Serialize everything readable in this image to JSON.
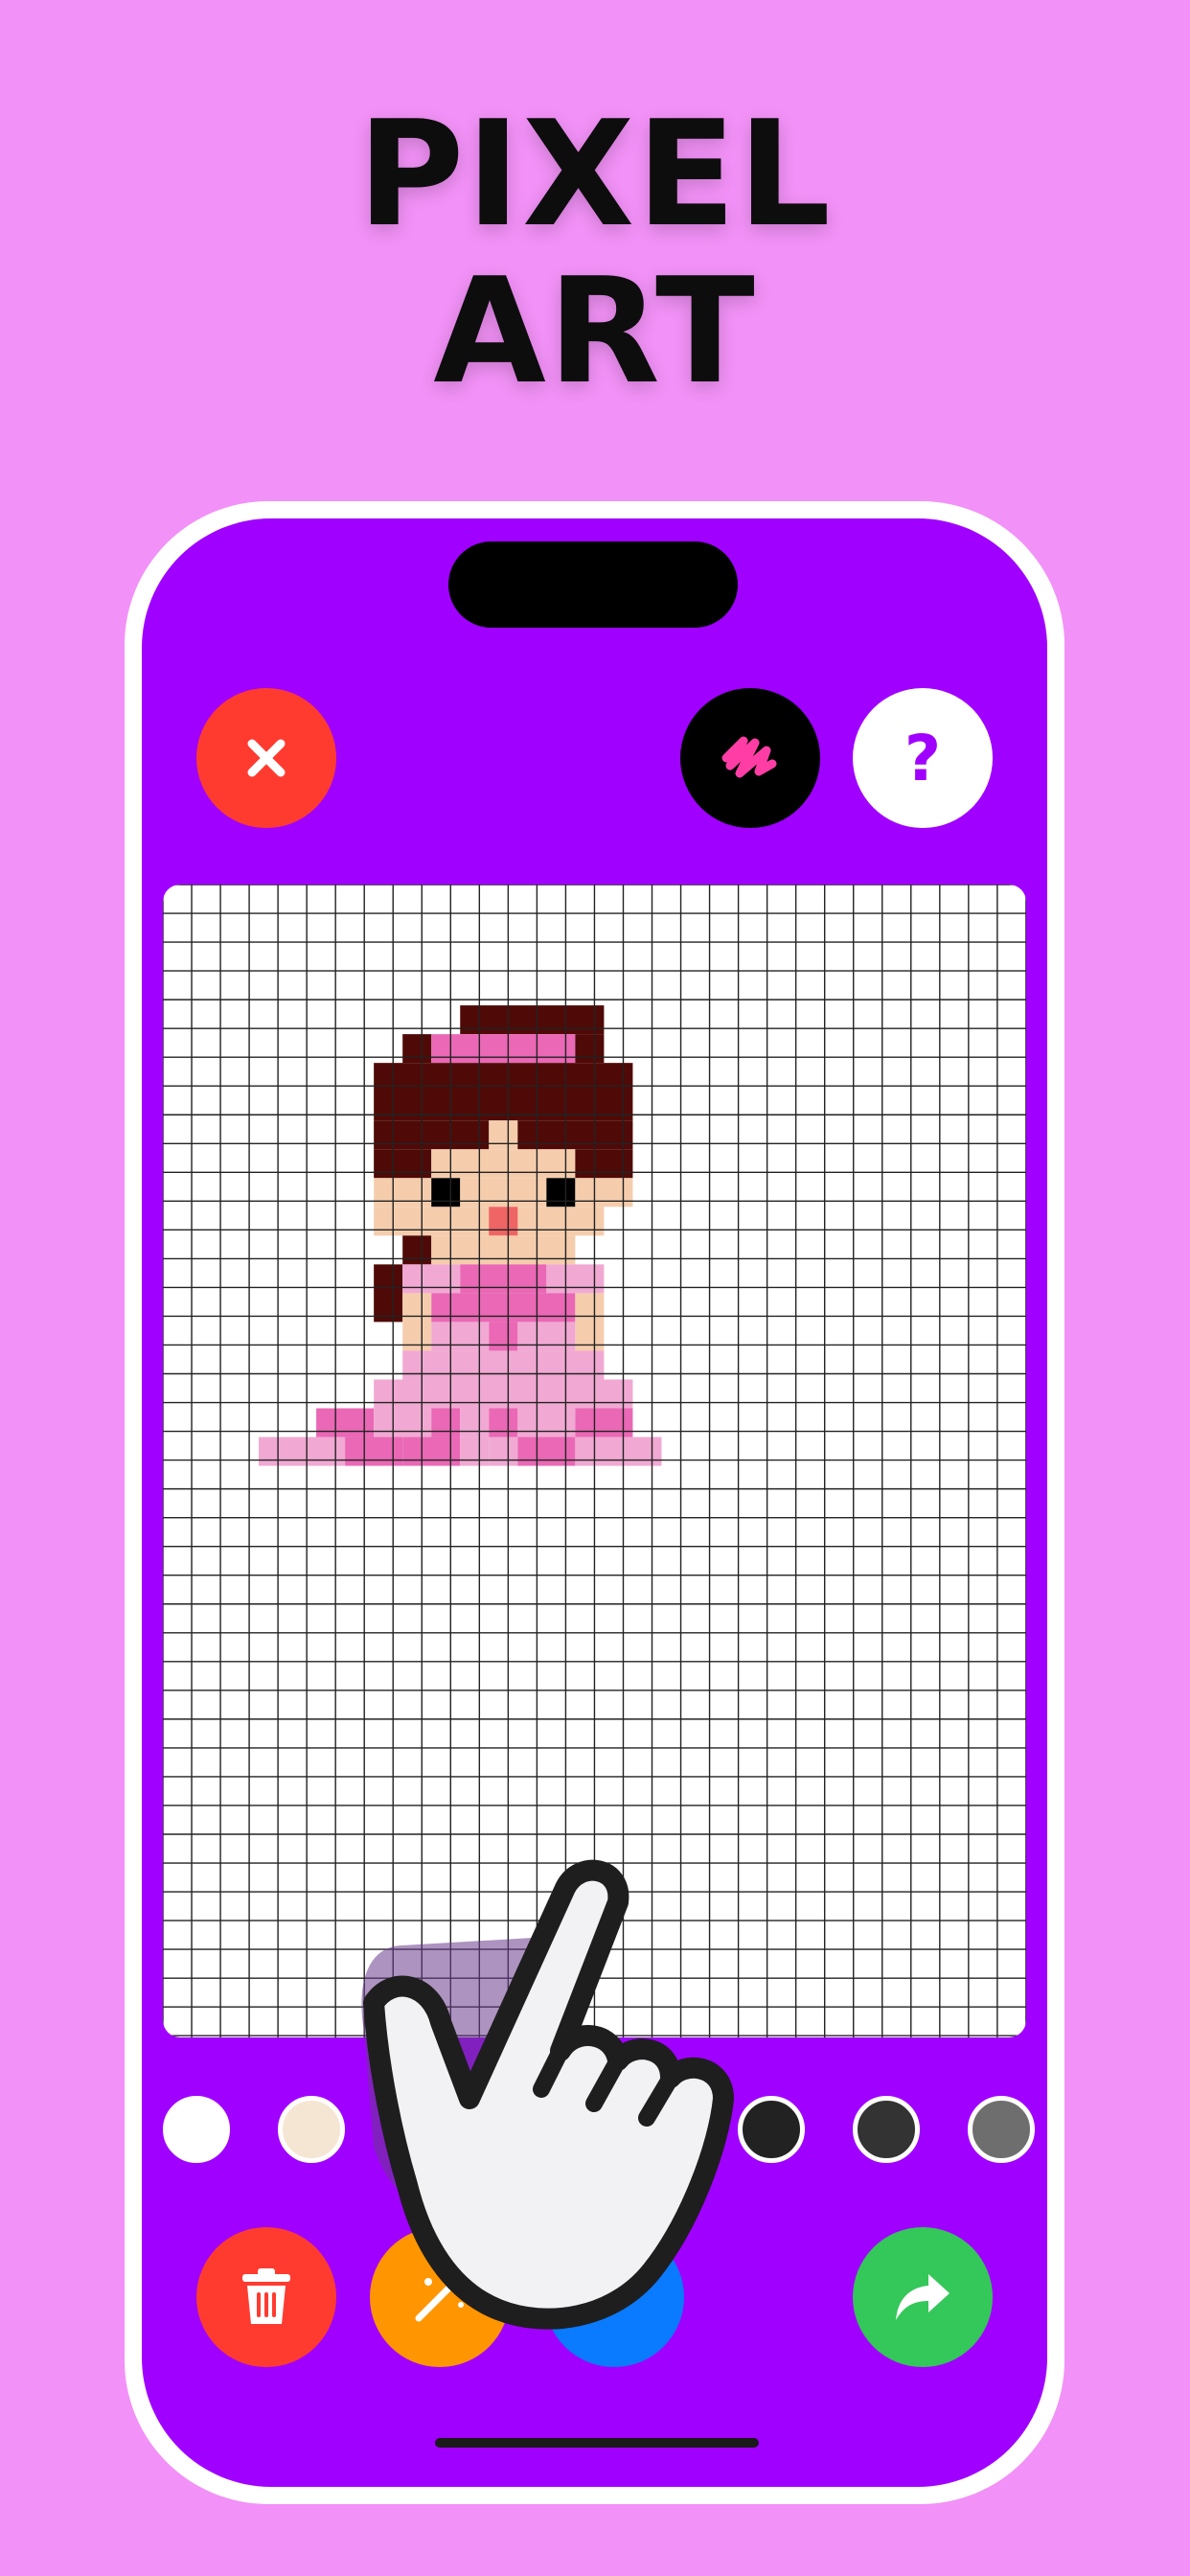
{
  "headline": {
    "line1": "PIXEL",
    "line2": "ART"
  },
  "toolbar_top": {
    "close_icon": "close-icon",
    "scribble_icon": "scribble-icon",
    "help_label": "?"
  },
  "colors": {
    "background": "#F291F7",
    "screen": "#A000FF",
    "dark_brown": "#4F0A07",
    "pink": "#EA68B5",
    "light_pink": "#F1A9D3",
    "skin": "#F5CDAD",
    "mouth": "#EF6464",
    "eye": "#000000"
  },
  "palette": [
    {
      "name": "white",
      "color": "#FFFFFF"
    },
    {
      "name": "cream",
      "color": "#F5E6D3"
    },
    {
      "name": "gray",
      "color": "#9B9B9B"
    },
    {
      "name": "swatch-4",
      "color": "#A000FF"
    },
    {
      "name": "swatch-5",
      "color": "#A000FF"
    },
    {
      "name": "black",
      "color": "#222222"
    },
    {
      "name": "dark-gray",
      "color": "#333333"
    },
    {
      "name": "mid-gray",
      "color": "#6E6E6E"
    }
  ],
  "toolbar_bottom": {
    "delete_icon": "trash-icon",
    "magic_icon": "magic-wand-icon",
    "pen_icon": "pen-icon",
    "share_icon": "share-arrow-icon"
  }
}
